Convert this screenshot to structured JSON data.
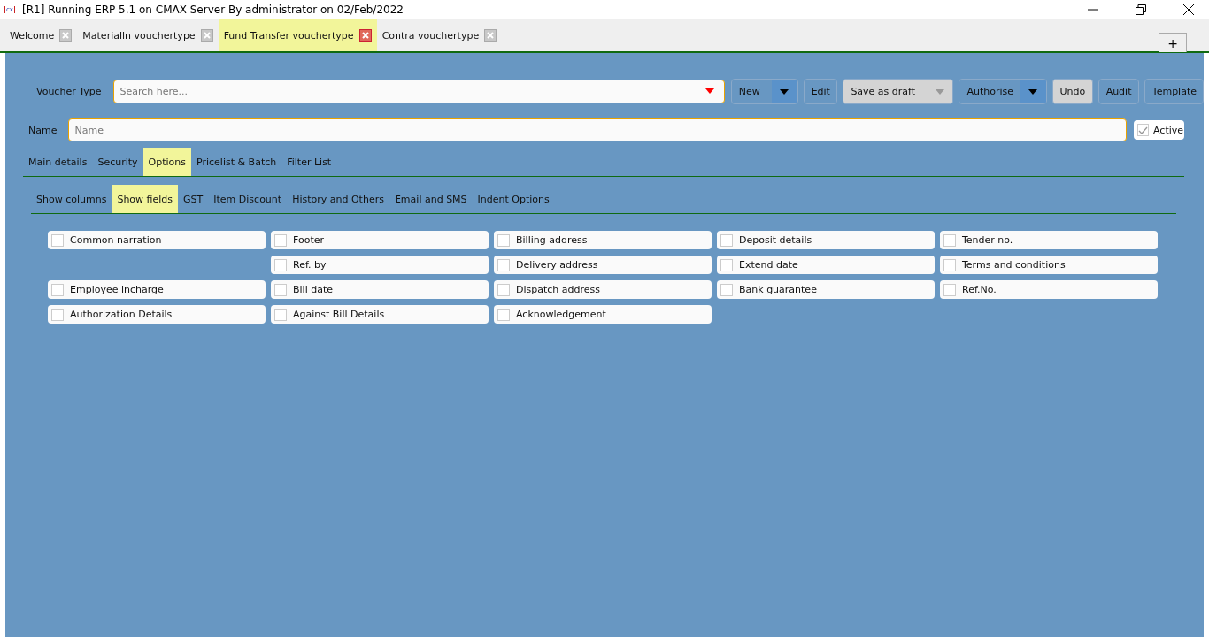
{
  "window": {
    "app_icon": "cx",
    "title": "[R1] Running ERP 5.1 on CMAX Server By administrator on 02/Feb/2022"
  },
  "doc_tabs": [
    {
      "label": "Welcome",
      "selected": false
    },
    {
      "label": "Materialln vouchertype",
      "selected": false
    },
    {
      "label": "Fund Transfer vouchertype",
      "selected": true
    },
    {
      "label": "Contra vouchertype",
      "selected": false
    }
  ],
  "add_tab": "+",
  "toolbar": {
    "label": "Voucher Type",
    "search": {
      "placeholder": "Search here..."
    },
    "buttons": [
      {
        "label": "New",
        "kind": "split",
        "shaded": false
      },
      {
        "label": "Edit",
        "kind": "plain",
        "shaded": false
      },
      {
        "label": "Save as draft",
        "kind": "split",
        "shaded": true
      },
      {
        "label": "Authorise",
        "kind": "split",
        "shaded": false
      },
      {
        "label": "Undo",
        "kind": "plain",
        "shaded": true
      },
      {
        "label": "Audit",
        "kind": "plain",
        "shaded": false
      },
      {
        "label": "Template",
        "kind": "plain",
        "shaded": false
      }
    ]
  },
  "name_row": {
    "label": "Name",
    "placeholder": "Name",
    "active": {
      "label": "Active",
      "checked": true
    }
  },
  "tabs": [
    {
      "label": "Main details",
      "selected": false
    },
    {
      "label": "Security",
      "selected": false
    },
    {
      "label": "Options",
      "selected": true
    },
    {
      "label": "Pricelist & Batch",
      "selected": false
    },
    {
      "label": "Filter List",
      "selected": false
    }
  ],
  "subtabs": [
    {
      "label": "Show columns",
      "selected": false
    },
    {
      "label": "Show fields",
      "selected": true
    },
    {
      "label": "GST",
      "selected": false
    },
    {
      "label": "Item Discount",
      "selected": false
    },
    {
      "label": "History and Others",
      "selected": false
    },
    {
      "label": "Email and SMS",
      "selected": false
    },
    {
      "label": "Indent Options",
      "selected": false
    }
  ],
  "fields": [
    [
      {
        "kind": "option",
        "label": "Common narration",
        "checked": false
      },
      {
        "kind": "option",
        "label": "Footer",
        "checked": false
      },
      {
        "kind": "option",
        "label": "Billing address",
        "checked": false
      },
      {
        "kind": "option",
        "label": "Deposit details",
        "checked": false
      },
      {
        "kind": "option",
        "label": "Tender no.",
        "checked": false
      }
    ],
    [
      {
        "kind": "empty"
      },
      {
        "kind": "option",
        "label": "Ref. by",
        "checked": false
      },
      {
        "kind": "option",
        "label": "Delivery address",
        "checked": false
      },
      {
        "kind": "option",
        "label": "Extend date",
        "checked": false
      },
      {
        "kind": "option",
        "label": "Terms and conditions",
        "checked": false
      }
    ],
    [
      {
        "kind": "option",
        "label": "Employee incharge",
        "checked": false
      },
      {
        "kind": "option",
        "label": "Bill date",
        "checked": false
      },
      {
        "kind": "option",
        "label": "Dispatch address",
        "checked": false
      },
      {
        "kind": "option",
        "label": "Bank guarantee",
        "checked": false
      },
      {
        "kind": "option",
        "label": "Ref.No.",
        "checked": false
      }
    ],
    [
      {
        "kind": "option",
        "label": "Authorization Details",
        "checked": false
      },
      {
        "kind": "option",
        "label": "Against Bill Details",
        "checked": false
      },
      {
        "kind": "option",
        "label": "Acknowledgement",
        "checked": false
      },
      {
        "kind": "empty"
      },
      {
        "kind": "empty"
      }
    ]
  ]
}
